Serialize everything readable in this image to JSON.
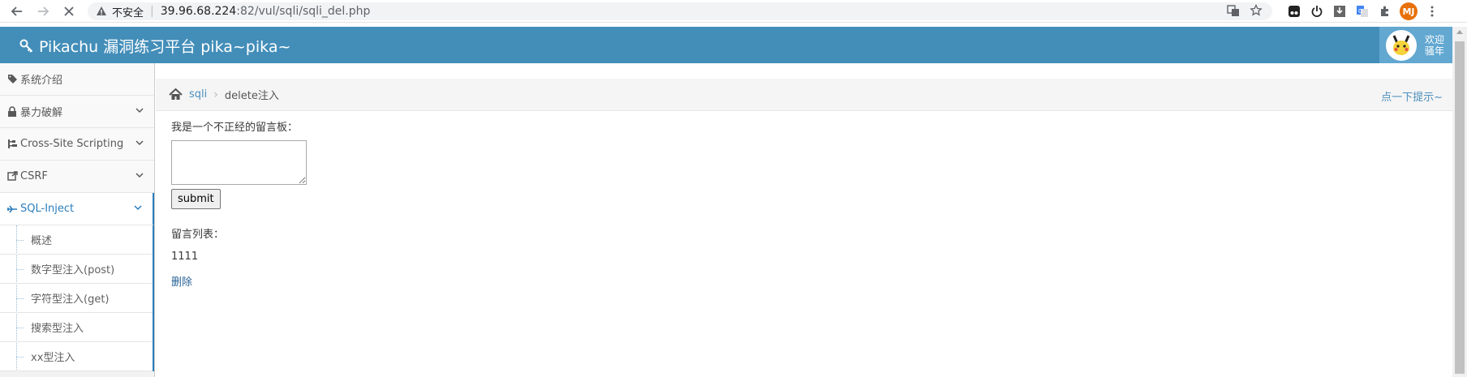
{
  "browser": {
    "security_label": "不安全",
    "url_host": "39.96.68.224",
    "url_rest": ":82/vul/sqli/sqli_del.php",
    "profile_initials": "MJ"
  },
  "navbar": {
    "brand": "Pikachu 漏洞练习平台 pika~pika~",
    "welcome_line1": "欢迎",
    "welcome_line2": "骚年",
    "color": "#438eb9"
  },
  "sidebar": {
    "items": [
      {
        "label": "系统介绍",
        "icon": "tags-icon"
      },
      {
        "label": "暴力破解",
        "icon": "lock-icon"
      },
      {
        "label": "Cross-Site Scripting",
        "icon": "sitemap-icon"
      },
      {
        "label": "CSRF",
        "icon": "share-icon"
      },
      {
        "label": "SQL-Inject",
        "icon": "fighter-jet-icon",
        "active": true
      }
    ],
    "sub_items": [
      {
        "label": "概述"
      },
      {
        "label": "数字型注入(post)"
      },
      {
        "label": "字符型注入(get)"
      },
      {
        "label": "搜索型注入"
      },
      {
        "label": "xx型注入"
      }
    ]
  },
  "breadcrumb": {
    "section": "sqli",
    "current": "delete注入",
    "hint": "点一下提示~"
  },
  "content": {
    "board_label": "我是一个不正经的留言板：",
    "textarea_value": "",
    "submit_label": "submit",
    "list_label": "留言列表：",
    "message": "1111",
    "delete_label": "删除"
  }
}
